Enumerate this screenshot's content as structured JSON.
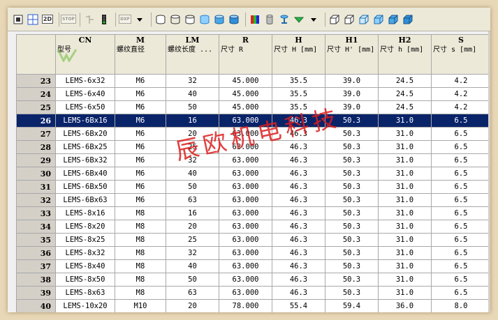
{
  "toolbar": {
    "items": [
      {
        "name": "pick-icon"
      },
      {
        "name": "grid-view-icon"
      },
      {
        "name": "2d-icon",
        "label": "2D"
      },
      {
        "name": "stop-icon",
        "label": "STOP"
      },
      {
        "name": "branch-icon"
      },
      {
        "name": "traffic-light-icon"
      },
      {
        "name": "dxf-export-icon",
        "label": "DXF"
      },
      {
        "name": "dropdown-arrow-icon"
      }
    ]
  },
  "columns": [
    {
      "code": "CN",
      "label": "型号"
    },
    {
      "code": "M",
      "label": "螺纹直径"
    },
    {
      "code": "LM",
      "label": "螺纹长度 ..."
    },
    {
      "code": "R",
      "label": "尺寸 R"
    },
    {
      "code": "H",
      "label": "尺寸 H [mm]"
    },
    {
      "code": "H1",
      "label": "尺寸 H' [mm]"
    },
    {
      "code": "H2",
      "label": "尺寸 h [mm]"
    },
    {
      "code": "S",
      "label": "尺寸 s [mm]"
    }
  ],
  "rows": [
    {
      "n": "23",
      "cells": [
        "LEMS-6x32",
        "M6",
        "32",
        "45.000",
        "35.5",
        "39.0",
        "24.5",
        "4.2"
      ]
    },
    {
      "n": "24",
      "cells": [
        "LEMS-6x40",
        "M6",
        "40",
        "45.000",
        "35.5",
        "39.0",
        "24.5",
        "4.2"
      ]
    },
    {
      "n": "25",
      "cells": [
        "LEMS-6x50",
        "M6",
        "50",
        "45.000",
        "35.5",
        "39.0",
        "24.5",
        "4.2"
      ]
    },
    {
      "n": "26",
      "cells": [
        "LEMS-6Bx16",
        "M6",
        "16",
        "63.000",
        "46.3",
        "50.3",
        "31.0",
        "6.5"
      ],
      "selected": true
    },
    {
      "n": "27",
      "cells": [
        "LEMS-6Bx20",
        "M6",
        "20",
        "63.000",
        "46.3",
        "50.3",
        "31.0",
        "6.5"
      ]
    },
    {
      "n": "28",
      "cells": [
        "LEMS-6Bx25",
        "M6",
        "25",
        "63.000",
        "46.3",
        "50.3",
        "31.0",
        "6.5"
      ]
    },
    {
      "n": "29",
      "cells": [
        "LEMS-6Bx32",
        "M6",
        "32",
        "63.000",
        "46.3",
        "50.3",
        "31.0",
        "6.5"
      ]
    },
    {
      "n": "30",
      "cells": [
        "LEMS-6Bx40",
        "M6",
        "40",
        "63.000",
        "46.3",
        "50.3",
        "31.0",
        "6.5"
      ]
    },
    {
      "n": "31",
      "cells": [
        "LEMS-6Bx50",
        "M6",
        "50",
        "63.000",
        "46.3",
        "50.3",
        "31.0",
        "6.5"
      ]
    },
    {
      "n": "32",
      "cells": [
        "LEMS-6Bx63",
        "M6",
        "63",
        "63.000",
        "46.3",
        "50.3",
        "31.0",
        "6.5"
      ]
    },
    {
      "n": "33",
      "cells": [
        "LEMS-8x16",
        "M8",
        "16",
        "63.000",
        "46.3",
        "50.3",
        "31.0",
        "6.5"
      ]
    },
    {
      "n": "34",
      "cells": [
        "LEMS-8x20",
        "M8",
        "20",
        "63.000",
        "46.3",
        "50.3",
        "31.0",
        "6.5"
      ]
    },
    {
      "n": "35",
      "cells": [
        "LEMS-8x25",
        "M8",
        "25",
        "63.000",
        "46.3",
        "50.3",
        "31.0",
        "6.5"
      ]
    },
    {
      "n": "36",
      "cells": [
        "LEMS-8x32",
        "M8",
        "32",
        "63.000",
        "46.3",
        "50.3",
        "31.0",
        "6.5"
      ]
    },
    {
      "n": "37",
      "cells": [
        "LEMS-8x40",
        "M8",
        "40",
        "63.000",
        "46.3",
        "50.3",
        "31.0",
        "6.5"
      ]
    },
    {
      "n": "38",
      "cells": [
        "LEMS-8x50",
        "M8",
        "50",
        "63.000",
        "46.3",
        "50.3",
        "31.0",
        "6.5"
      ]
    },
    {
      "n": "39",
      "cells": [
        "LEMS-8x63",
        "M8",
        "63",
        "63.000",
        "46.3",
        "50.3",
        "31.0",
        "6.5"
      ]
    },
    {
      "n": "40",
      "cells": [
        "LEMS-10x20",
        "M10",
        "20",
        "78.000",
        "55.4",
        "59.4",
        "36.0",
        "8.0"
      ]
    }
  ],
  "watermark": "辰欧机电科技",
  "colors": {
    "selection": "#0a246a",
    "background": "#e9d8b8",
    "watermark": "#dc1e1e"
  }
}
